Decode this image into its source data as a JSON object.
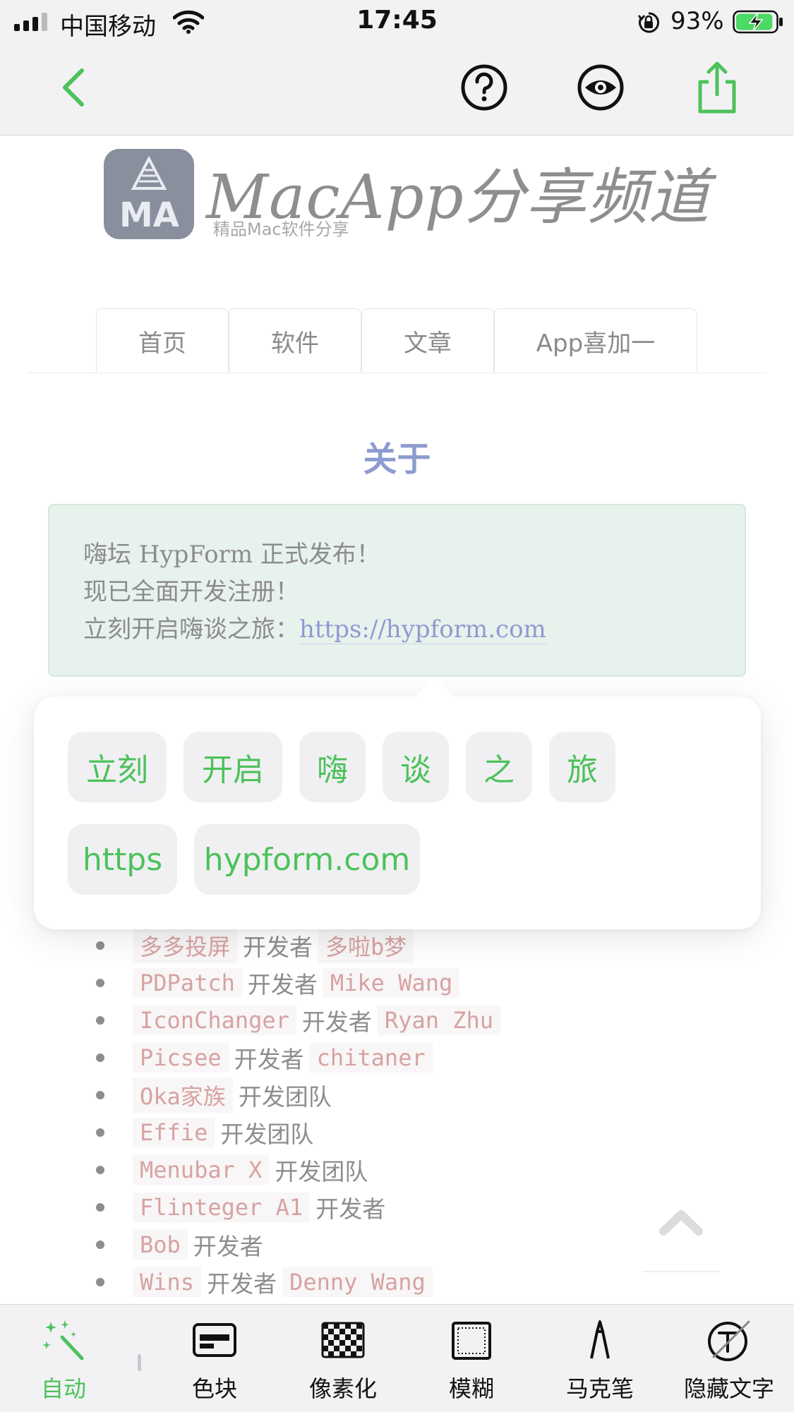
{
  "status_bar": {
    "carrier": "中国移动",
    "time": "17:45",
    "battery_percent": "93%",
    "battery_level": 0.93,
    "battery_charging": true
  },
  "nav_bar": {
    "icons": [
      "back-chevron-icon",
      "help-circle-icon",
      "eye-icon",
      "share-icon"
    ],
    "accent_color": "#4cc25a"
  },
  "page": {
    "logo": {
      "badge_text": "MA",
      "title": "MacApp分享频道",
      "subtitle": "精品Mac软件分享"
    },
    "tabs": [
      {
        "label": "首页"
      },
      {
        "label": "软件"
      },
      {
        "label": "文章"
      },
      {
        "label": "App喜加一"
      }
    ],
    "heading": "关于",
    "notice": {
      "line1": "嗨坛 HypForm 正式发布！",
      "line2": "现已全面开发注册！",
      "line3_prefix": "立刻开启嗨谈之旅：",
      "link": "https://hypform.com"
    },
    "developers": [
      {
        "app": "多多投屏",
        "role": "开发者",
        "name": "多啦b梦"
      },
      {
        "app": "PDPatch",
        "role": "开发者",
        "name": "Mike Wang"
      },
      {
        "app": "IconChanger",
        "role": "开发者",
        "name": "Ryan Zhu"
      },
      {
        "app": "Picsee",
        "role": "开发者",
        "name": "chitaner"
      },
      {
        "app": "Oka家族",
        "role": "开发团队",
        "name": ""
      },
      {
        "app": "Effie",
        "role": "开发团队",
        "name": ""
      },
      {
        "app": "Menubar X",
        "role": "开发团队",
        "name": ""
      },
      {
        "app": "Flinteger A1",
        "role": "开发者",
        "name": ""
      },
      {
        "app": "Bob",
        "role": "开发者",
        "name": ""
      },
      {
        "app": "Wins",
        "role": "开发者",
        "name": "Denny Wang"
      }
    ]
  },
  "word_picker": {
    "row1": [
      "立刻",
      "开启",
      "嗨",
      "谈",
      "之",
      "旅"
    ],
    "row2": [
      "https",
      "hypform.com"
    ]
  },
  "toolbar": {
    "items": [
      {
        "label": "自动",
        "icon": "magic-wand-icon",
        "active": true
      },
      {
        "label": "色块",
        "icon": "color-block-icon",
        "active": false
      },
      {
        "label": "像素化",
        "icon": "pixelate-icon",
        "active": false
      },
      {
        "label": "模糊",
        "icon": "blur-icon",
        "active": false
      },
      {
        "label": "马克笔",
        "icon": "marker-icon",
        "active": false
      },
      {
        "label": "隐藏文字",
        "icon": "hide-text-icon",
        "active": false
      }
    ]
  }
}
